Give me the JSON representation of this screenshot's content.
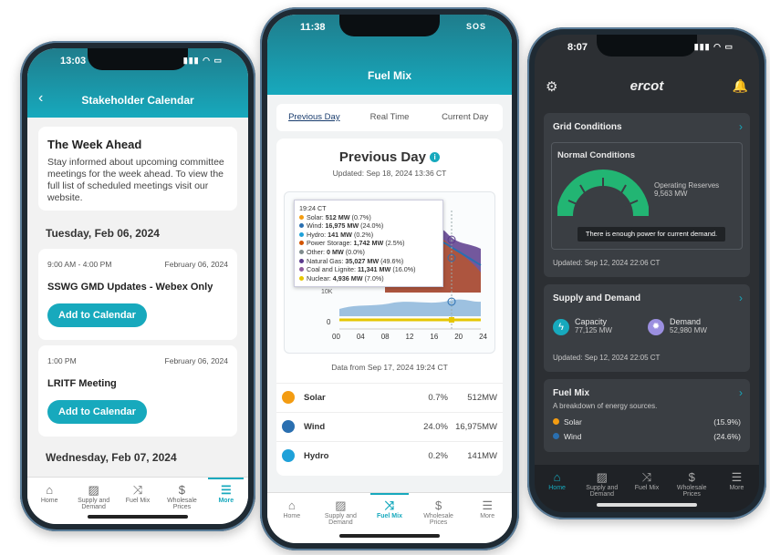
{
  "colors": {
    "teal": "#17a9bd",
    "dark_bg": "#2c2f33",
    "gauge_green": "#22b573"
  },
  "phone1": {
    "time": "13:03",
    "header": "Stakeholder Calendar",
    "week": {
      "title": "The Week Ahead",
      "text": "Stay informed about upcoming committee meetings for the week ahead. To view the full list of scheduled meetings visit our website."
    },
    "day1": "Tuesday, Feb 06, 2024",
    "meeting1": {
      "time": "9:00 AM - 4:00 PM",
      "date": "February 06, 2024",
      "title": "SSWG GMD Updates - Webex Only",
      "button": "Add to Calendar"
    },
    "meeting2": {
      "time": "1:00 PM",
      "date": "February 06, 2024",
      "title": "LRITF Meeting",
      "button": "Add to Calendar"
    },
    "day2": "Wednesday, Feb 07, 2024",
    "tabs": [
      "Home",
      "Supply and Demand",
      "Fuel Mix",
      "Wholesale Prices",
      "More"
    ]
  },
  "phone2": {
    "time": "11:38",
    "status_icons": "SOS",
    "header": "Fuel Mix",
    "segments": [
      "Previous Day",
      "Real Time",
      "Current Day"
    ],
    "card_title": "Previous Day",
    "updated": "Updated: Sep 18, 2024 13:36 CT",
    "tooltip": {
      "time": "19:24 CT",
      "rows": [
        {
          "label": "Solar:",
          "value": "512 MW",
          "pct": "(0.7%)",
          "color": "#f39c12"
        },
        {
          "label": "Wind:",
          "value": "16,975 MW",
          "pct": "(24.0%)",
          "color": "#2a6fb0"
        },
        {
          "label": "Hydro:",
          "value": "141 MW",
          "pct": "(0.2%)",
          "color": "#1fa1d9"
        },
        {
          "label": "Power Storage:",
          "value": "1,742 MW",
          "pct": "(2.5%)",
          "color": "#d35400"
        },
        {
          "label": "Other:",
          "value": "0 MW",
          "pct": "(0.0%)",
          "color": "#7f8c8d"
        },
        {
          "label": "Natural Gas:",
          "value": "35,027 MW",
          "pct": "(49.6%)",
          "color": "#5b3b8c"
        },
        {
          "label": "Coal and Lignite:",
          "value": "11,341 MW",
          "pct": "(16.0%)",
          "color": "#8e5c9e"
        },
        {
          "label": "Nuclear:",
          "value": "4,936 MW",
          "pct": "(7.0%)",
          "color": "#e6c600"
        }
      ]
    },
    "axis_ticks": [
      "00",
      "04",
      "08",
      "12",
      "16",
      "20",
      "24"
    ],
    "y_zero": "0",
    "y_partial": "10K",
    "data_from": "Data from Sep 17, 2024 19:24 CT",
    "fuels": [
      {
        "name": "Solar",
        "pct": "0.7%",
        "mw": "512MW",
        "color": "#f39c12"
      },
      {
        "name": "Wind",
        "pct": "24.0%",
        "mw": "16,975MW",
        "color": "#2a6fb0"
      },
      {
        "name": "Hydro",
        "pct": "0.2%",
        "mw": "141MW",
        "color": "#1fa1d9"
      }
    ],
    "tabs": [
      "Home",
      "Supply and Demand",
      "Fuel Mix",
      "Wholesale Prices",
      "More"
    ]
  },
  "phone3": {
    "time": "8:07",
    "logo": "ercot",
    "grid": {
      "title": "Grid Conditions",
      "status": "Normal Conditions",
      "reserves_label": "Operating Reserves",
      "reserves_value": "9,563 MW",
      "message": "There is enough power for current demand.",
      "updated": "Updated: Sep 12, 2024 22:06 CT"
    },
    "supply": {
      "title": "Supply and Demand",
      "capacity_label": "Capacity",
      "capacity_value": "77,125 MW",
      "demand_label": "Demand",
      "demand_value": "52,980 MW",
      "updated": "Updated: Sep 12, 2024 22:05 CT"
    },
    "fuelmix": {
      "title": "Fuel Mix",
      "subtitle": "A breakdown of energy sources.",
      "rows": [
        {
          "name": "Solar",
          "pct": "(15.9%)",
          "color": "#f39c12"
        },
        {
          "name": "Wind",
          "pct": "(24.6%)",
          "color": "#2a6fb0"
        }
      ]
    },
    "tabs": [
      "Home",
      "Supply and Demand",
      "Fuel Mix",
      "Wholesale Prices",
      "More"
    ]
  }
}
